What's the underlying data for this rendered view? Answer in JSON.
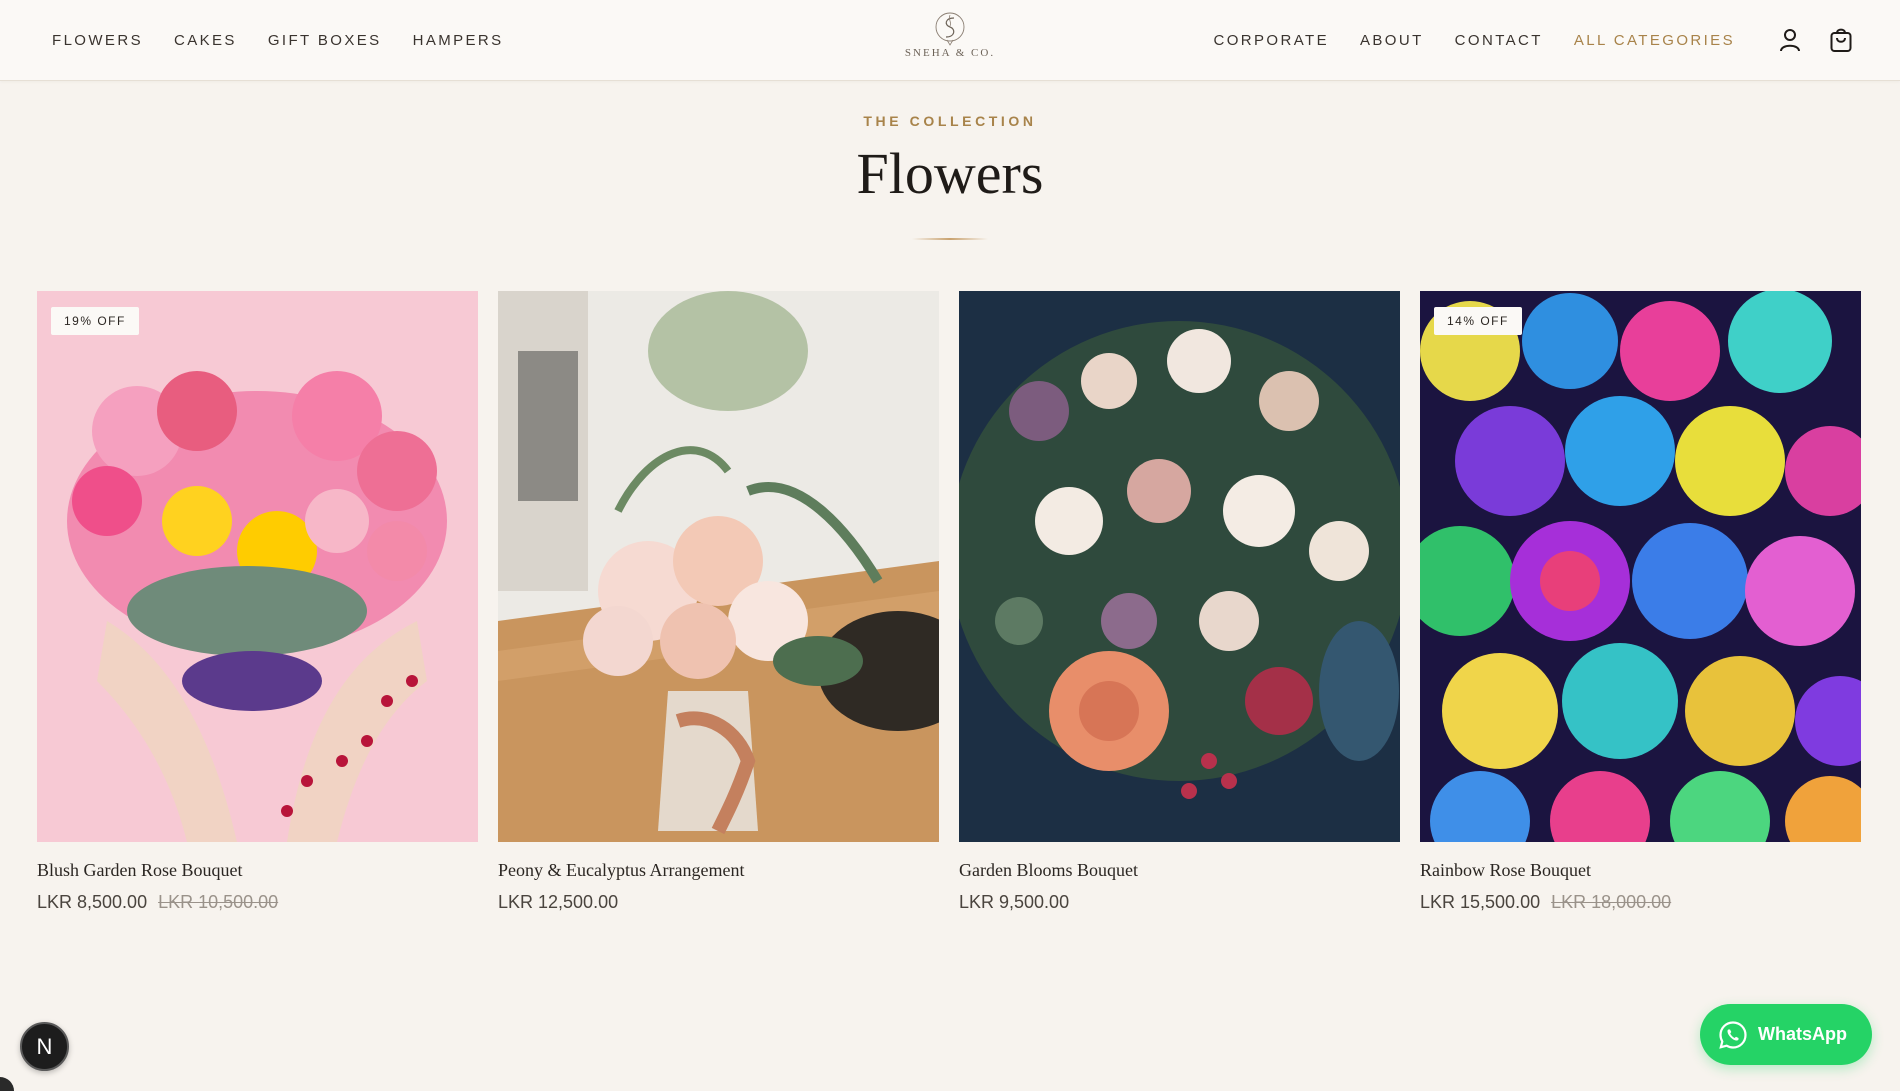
{
  "header": {
    "nav_left": [
      "FLOWERS",
      "CAKES",
      "GIFT BOXES",
      "HAMPERS"
    ],
    "nav_right": [
      "CORPORATE",
      "ABOUT",
      "CONTACT",
      "ALL CATEGORIES"
    ],
    "logo_text": "SNEHA & CO.",
    "icons": [
      "user-icon",
      "shopping-bag-icon"
    ]
  },
  "collection": {
    "eyebrow": "THE COLLECTION",
    "title": "Flowers"
  },
  "products": [
    {
      "name": "Blush Garden Rose Bouquet",
      "price": "LKR 8,500.00",
      "old_price": "LKR 10,500.00",
      "badge": "19% OFF"
    },
    {
      "name": "Peony & Eucalyptus Arrangement",
      "price": "LKR 12,500.00"
    },
    {
      "name": "Garden Blooms Bouquet",
      "price": "LKR 9,500.00"
    },
    {
      "name": "Rainbow Rose Bouquet",
      "price": "LKR 15,500.00",
      "old_price": "LKR 18,000.00",
      "badge": "14% OFF"
    }
  ],
  "floating": {
    "n_badge": "N",
    "whatsapp_label": "WhatsApp"
  },
  "colors": {
    "background": "#f7f3ee",
    "accent": "#a8834a",
    "whatsapp": "#25d366"
  }
}
